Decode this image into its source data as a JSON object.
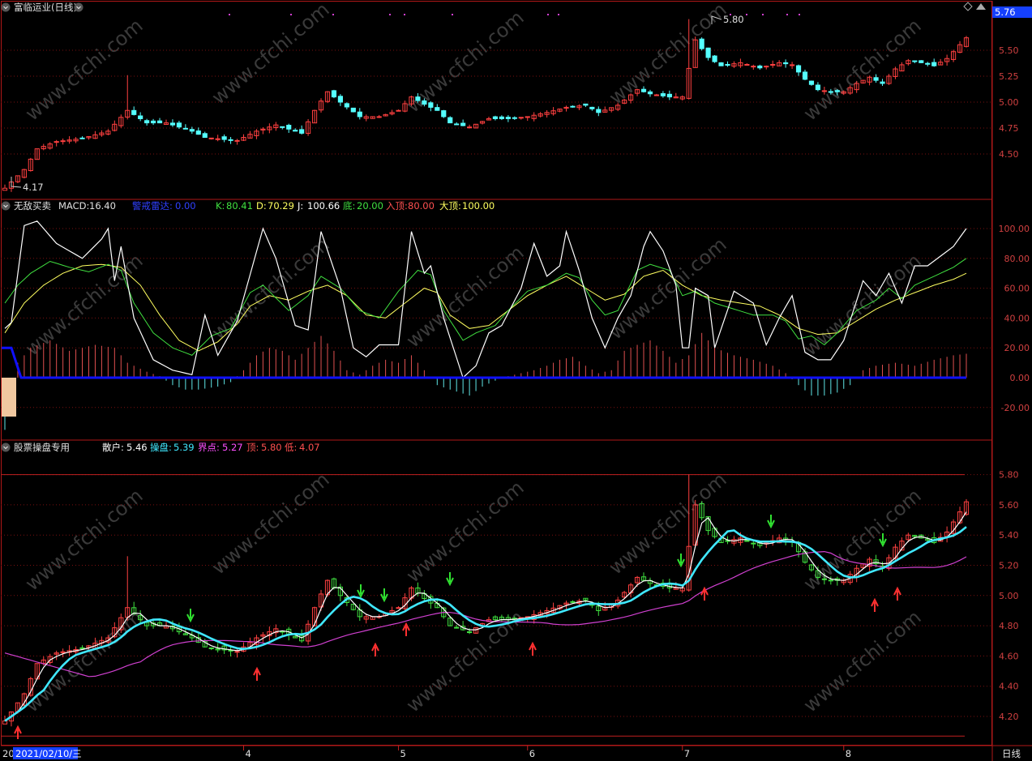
{
  "window": {
    "title": "富临运业(日线)",
    "period_tab": "日线",
    "current_price": "5.76",
    "cursor_date": "2021/02/10/三",
    "watermark": "www.cfchi.com"
  },
  "colors": {
    "up": "#ff4040",
    "down": "#54ffff",
    "grid": "#7a1010",
    "border": "#b01818",
    "axis_text": "#d04040",
    "blue": "#1010ff",
    "white": "#ffffff",
    "yellow": "#ffff60",
    "green": "#40e040",
    "magenta": "#ff50ff",
    "cyan": "#40e8ff"
  },
  "panel_price": {
    "high_label": "5.80",
    "low_label": "4.17",
    "ticks": [
      "5.50",
      "5.25",
      "5.00",
      "4.75",
      "4.50"
    ]
  },
  "panel_kdj": {
    "name": "无敌买卖",
    "macd_label": "MACD:",
    "macd_value": "16.40",
    "warn_label": "警戒雷达:",
    "warn_value": "0.00",
    "k_label": "K:",
    "k_value": "80.41",
    "d_label": "D:",
    "d_value": "70.29",
    "j_label": "J:",
    "j_value": "100.66",
    "bottom_label": "底:",
    "bottom_value": "20.00",
    "enter_label": "入顶:",
    "enter_value": "80.00",
    "top_label": "大顶:",
    "top_value": "100.00",
    "ticks": [
      "100.00",
      "80.00",
      "60.00",
      "40.00",
      "20.00",
      "0.00",
      "-20.00"
    ]
  },
  "panel_op": {
    "name": "股票操盘专用",
    "retail_label": "散户:",
    "retail_value": "5.46",
    "operator_label": "操盘:",
    "operator_value": "5.39",
    "boundary_label": "界点:",
    "boundary_value": "5.27",
    "top_label": "顶:",
    "top_value": "5.80",
    "low_label": "低:",
    "low_value": "4.07",
    "ticks": [
      "5.80",
      "5.60",
      "5.40",
      "5.20",
      "5.00",
      "4.80",
      "4.60",
      "4.40",
      "4.20"
    ]
  },
  "x_axis": {
    "labels": [
      "20",
      "4",
      "5",
      "6",
      "7",
      "8"
    ]
  },
  "chart_data": {
    "type": "candlestick",
    "series_count": 150,
    "price_range": [
      4.07,
      5.8
    ],
    "kdj_range": [
      -35,
      108
    ],
    "op_range": [
      4.07,
      5.85
    ],
    "month_ticks": [
      {
        "label": "4",
        "index": 37
      },
      {
        "label": "5",
        "index": 61
      },
      {
        "label": "6",
        "index": 81
      },
      {
        "label": "7",
        "index": 105
      },
      {
        "label": "8",
        "index": 130
      }
    ],
    "close_anchors": [
      [
        0,
        4.17
      ],
      [
        3,
        4.35
      ],
      [
        5,
        4.55
      ],
      [
        8,
        4.62
      ],
      [
        12,
        4.65
      ],
      [
        16,
        4.72
      ],
      [
        19,
        4.92
      ],
      [
        22,
        4.8
      ],
      [
        25,
        4.8
      ],
      [
        29,
        4.72
      ],
      [
        31,
        4.66
      ],
      [
        34,
        4.64
      ],
      [
        36,
        4.63
      ],
      [
        39,
        4.72
      ],
      [
        42,
        4.78
      ],
      [
        44,
        4.74
      ],
      [
        46,
        4.7
      ],
      [
        48,
        4.92
      ],
      [
        50,
        5.1
      ],
      [
        52,
        5.0
      ],
      [
        55,
        4.86
      ],
      [
        58,
        4.86
      ],
      [
        61,
        4.92
      ],
      [
        63,
        5.05
      ],
      [
        65,
        4.98
      ],
      [
        67,
        4.92
      ],
      [
        69,
        4.8
      ],
      [
        72,
        4.76
      ],
      [
        75,
        4.84
      ],
      [
        78,
        4.84
      ],
      [
        81,
        4.86
      ],
      [
        84,
        4.9
      ],
      [
        87,
        4.95
      ],
      [
        90,
        4.97
      ],
      [
        92,
        4.9
      ],
      [
        95,
        4.97
      ],
      [
        98,
        5.12
      ],
      [
        100,
        5.08
      ],
      [
        103,
        5.05
      ],
      [
        105,
        5.05
      ],
      [
        107,
        5.6
      ],
      [
        109,
        5.43
      ],
      [
        111,
        5.35
      ],
      [
        114,
        5.38
      ],
      [
        117,
        5.33
      ],
      [
        120,
        5.38
      ],
      [
        122,
        5.36
      ],
      [
        124,
        5.22
      ],
      [
        126,
        5.12
      ],
      [
        128,
        5.1
      ],
      [
        130,
        5.1
      ],
      [
        132,
        5.18
      ],
      [
        134,
        5.24
      ],
      [
        136,
        5.18
      ],
      [
        138,
        5.32
      ],
      [
        140,
        5.4
      ],
      [
        142,
        5.38
      ],
      [
        144,
        5.35
      ],
      [
        146,
        5.42
      ],
      [
        149,
        5.62
      ]
    ],
    "k_anchors": [
      [
        0,
        50
      ],
      [
        2,
        62
      ],
      [
        4,
        70
      ],
      [
        7,
        78
      ],
      [
        10,
        74
      ],
      [
        13,
        71
      ],
      [
        16,
        76
      ],
      [
        18,
        72
      ],
      [
        20,
        50
      ],
      [
        23,
        30
      ],
      [
        26,
        20
      ],
      [
        29,
        15
      ],
      [
        32,
        28
      ],
      [
        35,
        33
      ],
      [
        38,
        57
      ],
      [
        40,
        62
      ],
      [
        44,
        45
      ],
      [
        47,
        55
      ],
      [
        49,
        68
      ],
      [
        52,
        60
      ],
      [
        55,
        45
      ],
      [
        58,
        40
      ],
      [
        61,
        58
      ],
      [
        64,
        72
      ],
      [
        66,
        69
      ],
      [
        68,
        45
      ],
      [
        71,
        25
      ],
      [
        73,
        30
      ],
      [
        76,
        35
      ],
      [
        78,
        45
      ],
      [
        81,
        58
      ],
      [
        84,
        62
      ],
      [
        87,
        70
      ],
      [
        89,
        67
      ],
      [
        91,
        52
      ],
      [
        93,
        42
      ],
      [
        95,
        45
      ],
      [
        98,
        72
      ],
      [
        100,
        76
      ],
      [
        103,
        72
      ],
      [
        105,
        55
      ],
      [
        107,
        58
      ],
      [
        110,
        50
      ],
      [
        113,
        46
      ],
      [
        116,
        42
      ],
      [
        119,
        42
      ],
      [
        121,
        38
      ],
      [
        123,
        26
      ],
      [
        125,
        28
      ],
      [
        127,
        22
      ],
      [
        129,
        30
      ],
      [
        132,
        45
      ],
      [
        135,
        52
      ],
      [
        137,
        60
      ],
      [
        139,
        53
      ],
      [
        141,
        62
      ],
      [
        144,
        68
      ],
      [
        147,
        74
      ],
      [
        149,
        80
      ]
    ],
    "d_anchors": [
      [
        0,
        30
      ],
      [
        3,
        50
      ],
      [
        6,
        62
      ],
      [
        9,
        70
      ],
      [
        12,
        75
      ],
      [
        15,
        76
      ],
      [
        18,
        74
      ],
      [
        21,
        62
      ],
      [
        24,
        42
      ],
      [
        27,
        25
      ],
      [
        30,
        18
      ],
      [
        33,
        24
      ],
      [
        36,
        36
      ],
      [
        38,
        48
      ],
      [
        41,
        55
      ],
      [
        44,
        52
      ],
      [
        47,
        58
      ],
      [
        50,
        62
      ],
      [
        53,
        55
      ],
      [
        56,
        42
      ],
      [
        59,
        40
      ],
      [
        62,
        50
      ],
      [
        65,
        60
      ],
      [
        67,
        57
      ],
      [
        69,
        42
      ],
      [
        72,
        33
      ],
      [
        75,
        35
      ],
      [
        78,
        45
      ],
      [
        81,
        55
      ],
      [
        84,
        62
      ],
      [
        87,
        68
      ],
      [
        90,
        60
      ],
      [
        93,
        52
      ],
      [
        96,
        56
      ],
      [
        99,
        68
      ],
      [
        102,
        72
      ],
      [
        105,
        62
      ],
      [
        108,
        55
      ],
      [
        111,
        52
      ],
      [
        114,
        50
      ],
      [
        117,
        48
      ],
      [
        120,
        42
      ],
      [
        123,
        33
      ],
      [
        126,
        29
      ],
      [
        129,
        30
      ],
      [
        132,
        38
      ],
      [
        135,
        46
      ],
      [
        138,
        52
      ],
      [
        141,
        57
      ],
      [
        144,
        62
      ],
      [
        147,
        66
      ],
      [
        149,
        70
      ]
    ],
    "j_anchors": [
      [
        0,
        33
      ],
      [
        1,
        37
      ],
      [
        3,
        102
      ],
      [
        5,
        105
      ],
      [
        8,
        90
      ],
      [
        12,
        80
      ],
      [
        15,
        93
      ],
      [
        16,
        100
      ],
      [
        17,
        65
      ],
      [
        18,
        88
      ],
      [
        20,
        40
      ],
      [
        23,
        12
      ],
      [
        26,
        5
      ],
      [
        29,
        2
      ],
      [
        31,
        42
      ],
      [
        33,
        15
      ],
      [
        36,
        38
      ],
      [
        40,
        100
      ],
      [
        42,
        80
      ],
      [
        45,
        35
      ],
      [
        47,
        32
      ],
      [
        49,
        98
      ],
      [
        52,
        60
      ],
      [
        54,
        20
      ],
      [
        56,
        14
      ],
      [
        58,
        22
      ],
      [
        61,
        22
      ],
      [
        63,
        98
      ],
      [
        65,
        70
      ],
      [
        66,
        75
      ],
      [
        68,
        40
      ],
      [
        71,
        0
      ],
      [
        73,
        8
      ],
      [
        75,
        30
      ],
      [
        77,
        35
      ],
      [
        80,
        60
      ],
      [
        82,
        90
      ],
      [
        84,
        68
      ],
      [
        86,
        75
      ],
      [
        87,
        98
      ],
      [
        89,
        72
      ],
      [
        91,
        40
      ],
      [
        93,
        20
      ],
      [
        95,
        40
      ],
      [
        97,
        55
      ],
      [
        99,
        88
      ],
      [
        100,
        98
      ],
      [
        102,
        85
      ],
      [
        104,
        62
      ],
      [
        105,
        20
      ],
      [
        106,
        20
      ],
      [
        107,
        60
      ],
      [
        109,
        55
      ],
      [
        110,
        20
      ],
      [
        113,
        58
      ],
      [
        116,
        50
      ],
      [
        118,
        22
      ],
      [
        120,
        40
      ],
      [
        122,
        55
      ],
      [
        124,
        17
      ],
      [
        126,
        12
      ],
      [
        128,
        12
      ],
      [
        130,
        25
      ],
      [
        133,
        65
      ],
      [
        135,
        55
      ],
      [
        137,
        70
      ],
      [
        139,
        50
      ],
      [
        141,
        75
      ],
      [
        143,
        75
      ],
      [
        147,
        88
      ],
      [
        149,
        100
      ]
    ],
    "macd_anchors": [
      [
        0,
        -35
      ],
      [
        1,
        -20
      ],
      [
        2,
        10
      ],
      [
        4,
        20
      ],
      [
        7,
        25
      ],
      [
        10,
        18
      ],
      [
        14,
        22
      ],
      [
        17,
        20
      ],
      [
        19,
        10
      ],
      [
        22,
        4
      ],
      [
        24,
        1
      ],
      [
        26,
        -5
      ],
      [
        28,
        -8
      ],
      [
        30,
        -8
      ],
      [
        33,
        -6
      ],
      [
        35,
        -3
      ],
      [
        37,
        5
      ],
      [
        39,
        15
      ],
      [
        41,
        20
      ],
      [
        43,
        18
      ],
      [
        45,
        12
      ],
      [
        47,
        20
      ],
      [
        49,
        28
      ],
      [
        51,
        18
      ],
      [
        53,
        5
      ],
      [
        55,
        2
      ],
      [
        57,
        8
      ],
      [
        59,
        12
      ],
      [
        61,
        10
      ],
      [
        63,
        15
      ],
      [
        65,
        5
      ],
      [
        67,
        -5
      ],
      [
        69,
        -8
      ],
      [
        72,
        -12
      ],
      [
        74,
        -6
      ],
      [
        76,
        -2
      ],
      [
        78,
        1
      ],
      [
        80,
        3
      ],
      [
        82,
        5
      ],
      [
        84,
        8
      ],
      [
        86,
        12
      ],
      [
        88,
        14
      ],
      [
        90,
        8
      ],
      [
        92,
        3
      ],
      [
        94,
        5
      ],
      [
        96,
        18
      ],
      [
        98,
        22
      ],
      [
        100,
        25
      ],
      [
        102,
        18
      ],
      [
        104,
        10
      ],
      [
        106,
        15
      ],
      [
        108,
        30
      ],
      [
        110,
        20
      ],
      [
        113,
        15
      ],
      [
        116,
        12
      ],
      [
        119,
        8
      ],
      [
        121,
        3
      ],
      [
        123,
        -5
      ],
      [
        125,
        -12
      ],
      [
        127,
        -12
      ],
      [
        129,
        -10
      ],
      [
        131,
        -5
      ],
      [
        133,
        5
      ],
      [
        135,
        8
      ],
      [
        138,
        10
      ],
      [
        141,
        8
      ],
      [
        144,
        12
      ],
      [
        147,
        15
      ],
      [
        149,
        16
      ]
    ],
    "down_arrows": [
      36,
      70,
      75,
      90,
      135,
      151,
      173
    ],
    "up_arrows": [
      2,
      50,
      74,
      80,
      104,
      137,
      173,
      177
    ]
  }
}
